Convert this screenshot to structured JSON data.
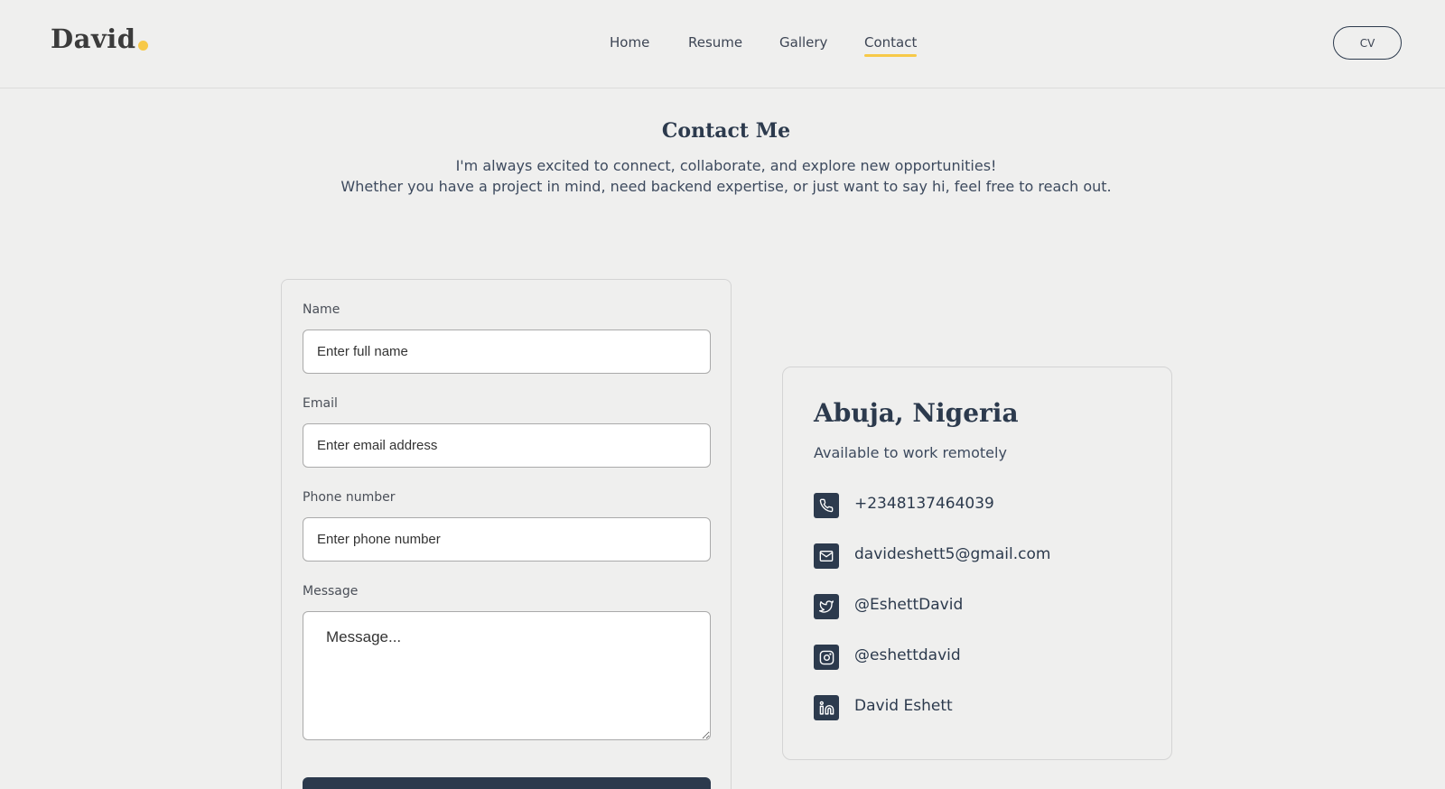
{
  "header": {
    "logo": "David",
    "nav": [
      {
        "label": "Home",
        "active": false
      },
      {
        "label": "Resume",
        "active": false
      },
      {
        "label": "Gallery",
        "active": false
      },
      {
        "label": "Contact",
        "active": true
      }
    ],
    "cv_label": "CV"
  },
  "intro": {
    "title": "Contact Me",
    "line1": "I'm always excited to connect, collaborate, and explore new opportunities!",
    "line2": "Whether you have a project in mind, need backend expertise, or just want to say hi, feel free to reach out."
  },
  "form": {
    "name_label": "Name",
    "name_placeholder": "Enter full name",
    "email_label": "Email",
    "email_placeholder": "Enter email address",
    "phone_label": "Phone number",
    "phone_placeholder": "Enter phone number",
    "message_label": "Message",
    "message_placeholder": "Message..."
  },
  "info": {
    "location": "Abuja, Nigeria",
    "availability": "Available to work remotely",
    "contacts": [
      {
        "icon": "phone-icon",
        "text": "+2348137464039"
      },
      {
        "icon": "mail-icon",
        "text": "davideshett5@gmail.com"
      },
      {
        "icon": "twitter-icon",
        "text": "@EshettDavid"
      },
      {
        "icon": "instagram-icon",
        "text": "@eshettdavid"
      },
      {
        "icon": "linkedin-icon",
        "text": "David Eshett"
      }
    ]
  },
  "colors": {
    "background": "#efefee",
    "primary": "#2c3a4d",
    "accent": "#f7c948"
  }
}
